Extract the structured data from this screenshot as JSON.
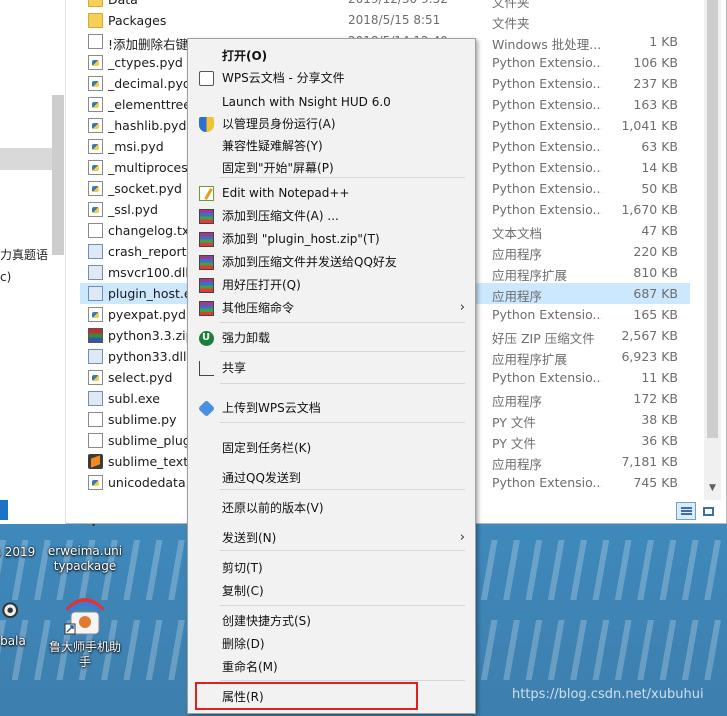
{
  "desktop": {
    "icons": [
      {
        "label_1": "s 2019",
        "label_2": ""
      },
      {
        "label_1": "erweima.uni",
        "label_2": "typackage"
      },
      {
        "label_1": "bala",
        "label_2": ""
      },
      {
        "label_1": "鲁大师手机助",
        "label_2": "手"
      }
    ],
    "watermark": "https://blog.csdn.net/xubuhui"
  },
  "nav_pane": {
    "fragment_1": "力真题语",
    "fragment_2": "c)"
  },
  "files": [
    {
      "name": "Data",
      "date": "2019/12/30 9:52",
      "type": "文件夹",
      "size": "",
      "icon": "folder-icon"
    },
    {
      "name": "Packages",
      "date": "2018/5/15 8:51",
      "type": "文件夹",
      "size": "",
      "icon": "folder-icon"
    },
    {
      "name": "!添加删除右键菜单.bat",
      "date": "2018/5/14 12:40",
      "type": "Windows 批处理...",
      "size": "1 KB",
      "icon": "batch-file-icon"
    },
    {
      "name": "_ctypes.pyd",
      "date": "",
      "type": "Python Extensio...",
      "size": "106 KB",
      "icon": "python-file-icon"
    },
    {
      "name": "_decimal.pyd",
      "date": "",
      "type": "Python Extensio...",
      "size": "237 KB",
      "icon": "python-file-icon"
    },
    {
      "name": "_elementtree.",
      "date": "",
      "type": "Python Extensio...",
      "size": "163 KB",
      "icon": "python-file-icon"
    },
    {
      "name": "_hashlib.pyd",
      "date": "",
      "type": "Python Extensio...",
      "size": "1,041 KB",
      "icon": "python-file-icon"
    },
    {
      "name": "_msi.pyd",
      "date": "",
      "type": "Python Extensio...",
      "size": "63 KB",
      "icon": "python-file-icon"
    },
    {
      "name": "_multiprocess",
      "date": "",
      "type": "Python Extensio...",
      "size": "14 KB",
      "icon": "python-file-icon"
    },
    {
      "name": "_socket.pyd",
      "date": "",
      "type": "Python Extensio...",
      "size": "50 KB",
      "icon": "python-file-icon"
    },
    {
      "name": "_ssl.pyd",
      "date": "",
      "type": "Python Extensio...",
      "size": "1,670 KB",
      "icon": "python-file-icon"
    },
    {
      "name": "changelog.txt",
      "date": "",
      "type": "文本文档",
      "size": "47 KB",
      "icon": "text-file-icon"
    },
    {
      "name": "crash_reporte",
      "date": "",
      "type": "应用程序",
      "size": "220 KB",
      "icon": "exe-file-icon"
    },
    {
      "name": "msvcr100.dll",
      "date": "",
      "type": "应用程序扩展",
      "size": "810 KB",
      "icon": "dll-file-icon"
    },
    {
      "name": "plugin_host.ex",
      "date": "",
      "type": "应用程序",
      "size": "687 KB",
      "icon": "exe-file-icon"
    },
    {
      "name": "pyexpat.pyd",
      "date": "",
      "type": "Python Extensio...",
      "size": "165 KB",
      "icon": "python-file-icon"
    },
    {
      "name": "python3.3.zip",
      "date": "",
      "type": "好压 ZIP 压缩文件",
      "size": "2,567 KB",
      "icon": "zip-file-icon"
    },
    {
      "name": "python33.dll",
      "date": "",
      "type": "应用程序扩展",
      "size": "6,923 KB",
      "icon": "dll-file-icon"
    },
    {
      "name": "select.pyd",
      "date": "",
      "type": "Python Extensio...",
      "size": "11 KB",
      "icon": "python-file-icon"
    },
    {
      "name": "subl.exe",
      "date": "",
      "type": "应用程序",
      "size": "172 KB",
      "icon": "exe-file-icon"
    },
    {
      "name": "sublime.py",
      "date": "",
      "type": "PY 文件",
      "size": "38 KB",
      "icon": "text-file-icon"
    },
    {
      "name": "sublime_plugi",
      "date": "",
      "type": "PY 文件",
      "size": "36 KB",
      "icon": "text-file-icon"
    },
    {
      "name": "sublime_text.e",
      "date": "",
      "type": "应用程序",
      "size": "7,181 KB",
      "icon": "sublime-icon"
    },
    {
      "name": "unicodedata.p",
      "date": "",
      "type": "Python Extensio...",
      "size": "745 KB",
      "icon": "python-file-icon"
    }
  ],
  "selected_file_index": 14,
  "context_menu": {
    "items": [
      {
        "label": "打开(O)",
        "bold": true,
        "icon": ""
      },
      {
        "label": "WPS云文档 - 分享文件",
        "icon": "wps-share-icon"
      },
      {
        "label": "Launch with Nsight HUD 6.0",
        "icon": ""
      },
      {
        "label": "以管理员身份运行(A)",
        "icon": "admin-shield-icon"
      },
      {
        "label": "兼容性疑难解答(Y)",
        "icon": ""
      },
      {
        "label": "固定到\"开始\"屏幕(P)",
        "icon": ""
      },
      {
        "label": "Edit with Notepad++",
        "icon": "notepad-plus-plus-icon"
      },
      {
        "label": "添加到压缩文件(A) ...",
        "icon": "winrar-icon"
      },
      {
        "label": "添加到 \"plugin_host.zip\"(T)",
        "icon": "winrar-icon"
      },
      {
        "label": "添加到压缩文件并发送给QQ好友",
        "icon": "winrar-icon"
      },
      {
        "label": "用好压打开(Q)",
        "icon": "winrar-icon"
      },
      {
        "label": "其他压缩命令",
        "icon": "winrar-icon",
        "submenu": true
      },
      {
        "label": "强力卸载",
        "icon": "uninstall-icon"
      },
      {
        "label": "共享",
        "icon": "share-icon"
      },
      {
        "label": "上传到WPS云文档",
        "icon": "wps-cloud-icon"
      },
      {
        "label": "固定到任务栏(K)",
        "icon": ""
      },
      {
        "label": "通过QQ发送到",
        "icon": ""
      },
      {
        "label": "还原以前的版本(V)",
        "icon": ""
      },
      {
        "label": "发送到(N)",
        "icon": "",
        "submenu": true
      },
      {
        "label": "剪切(T)",
        "icon": ""
      },
      {
        "label": "复制(C)",
        "icon": ""
      },
      {
        "label": "创建快捷方式(S)",
        "icon": ""
      },
      {
        "label": "删除(D)",
        "icon": ""
      },
      {
        "label": "重命名(M)",
        "icon": ""
      },
      {
        "label": "属性(R)",
        "icon": ""
      }
    ],
    "submenu_arrow": "›",
    "highlighted_item": "属性(R)",
    "highlight_color": "#e02020"
  },
  "colors": {
    "selection": "#cce8ff",
    "menu_bg": "#f2f2f2"
  }
}
